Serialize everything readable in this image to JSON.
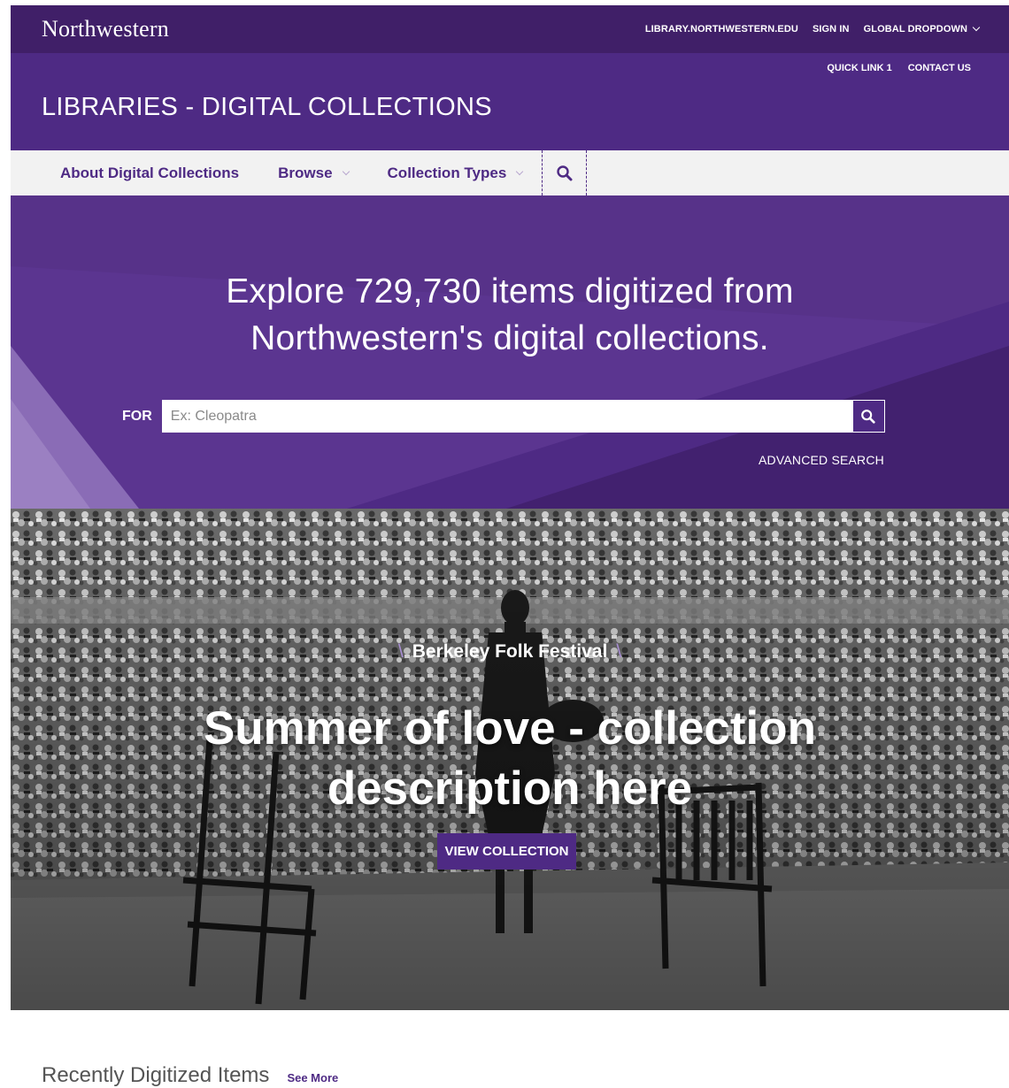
{
  "topbar": {
    "brand": "Northwestern",
    "links": [
      "LIBRARY.NORTHWESTERN.EDU",
      "SIGN IN"
    ],
    "dropdown_label": "GLOBAL DROPDOWN"
  },
  "header": {
    "quick_links": [
      "QUICK LINK 1",
      "CONTACT US"
    ],
    "title": "LIBRARIES - DIGITAL COLLECTIONS"
  },
  "nav": {
    "items": [
      "About Digital Collections",
      "Browse",
      "Collection Types"
    ],
    "search_icon": "search-icon"
  },
  "hero": {
    "headline_line1": "Explore 729,730 items digitized from",
    "headline_line2": "Northwestern's digital collections.",
    "for_label": "FOR",
    "search_placeholder": "Ex: Cleopatra",
    "search_value": "",
    "advanced_search": "ADVANCED SEARCH"
  },
  "feature": {
    "eyebrow": "Berkeley Folk Festival",
    "title_line1": "Summer of love - collection",
    "title_line2": "description here",
    "button": "VIEW COLLECTION"
  },
  "recent": {
    "heading": "Recently Digitized Items",
    "see_more": "See More"
  },
  "colors": {
    "brand_dark": "#401f68",
    "brand": "#4e2a84",
    "hero": "#5b3590",
    "nav_bg": "#f2f2f2"
  }
}
